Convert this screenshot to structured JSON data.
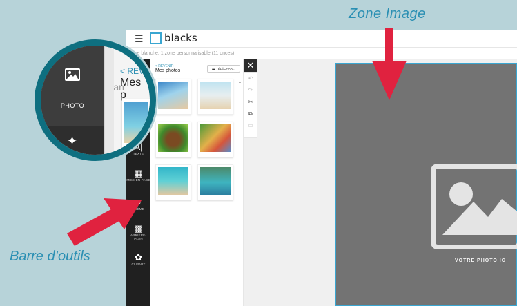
{
  "annotations": {
    "zone_image": "Zone Image",
    "barre_outils": "Barre d’outils"
  },
  "header": {
    "menu_icon": "☰",
    "logo_text": "blacks",
    "subtitle": "se blanche, 1 zone personnalisable (11 onces)"
  },
  "toolbar": {
    "items": [
      {
        "icon": "text-icon",
        "glyph": "A|",
        "label": "TEXTE"
      },
      {
        "icon": "layout-icon",
        "glyph": "▦",
        "label": "MISE EN PAGE"
      },
      {
        "icon": "palette-icon",
        "glyph": "🎨",
        "label": "THÈME"
      },
      {
        "icon": "background-icon",
        "glyph": "▩",
        "label": "ARRIÈRE-PLAN"
      },
      {
        "icon": "clipart-icon",
        "glyph": "✿",
        "label": "CLIPART"
      }
    ]
  },
  "panel": {
    "back_label": "< REVENIR",
    "title": "Mes photos",
    "upload_label": "TÉLÉCHAR...",
    "upload_icon": "folder-icon"
  },
  "edit_tools": [
    "undo-icon",
    "redo-icon",
    "cut-icon",
    "copy-icon",
    "paste-icon"
  ],
  "close_glyph": "✕",
  "canvas": {
    "placeholder_label": "VOTRE PHOTO IC"
  },
  "magnifier": {
    "behind_text": "ose blan",
    "photo_label": "PHOTO",
    "back_label": "< REV",
    "title": "Mes p"
  },
  "colors": {
    "background": "#b7d3d9",
    "accent": "#2a8fb3",
    "arrow": "#e0223f",
    "toolbar": "#202020",
    "canvas": "#737373"
  }
}
